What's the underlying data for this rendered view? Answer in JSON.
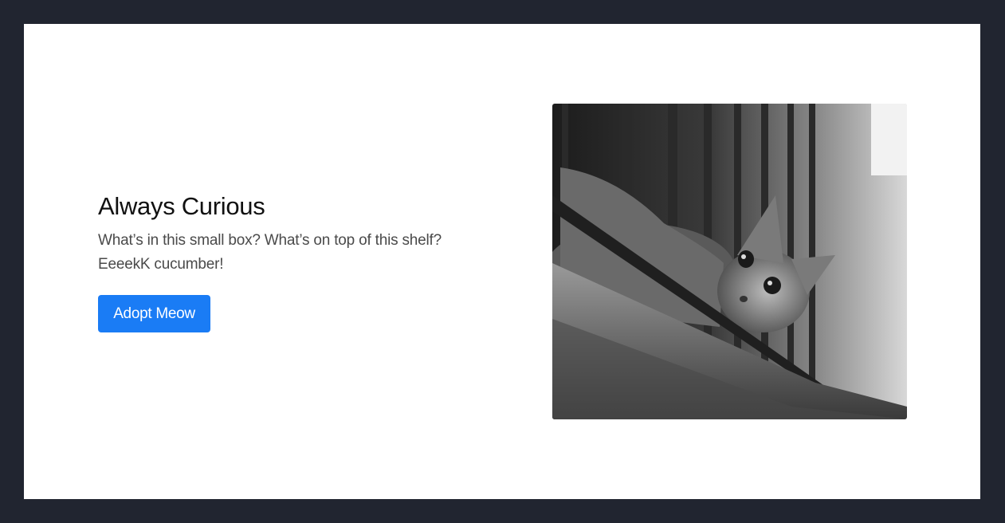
{
  "hero": {
    "title": "Always Curious",
    "description_line1": "What’s in this small box? What’s on top of this shelf?",
    "description_line2": "EeeekK cucumber!",
    "button_label": "Adopt Meow"
  },
  "image": {
    "subject": "black-and-white photo of a tabby cat peeking between window railings"
  },
  "colors": {
    "page_background": "#212530",
    "card_background": "#ffffff",
    "button": "#1a7cf5"
  }
}
